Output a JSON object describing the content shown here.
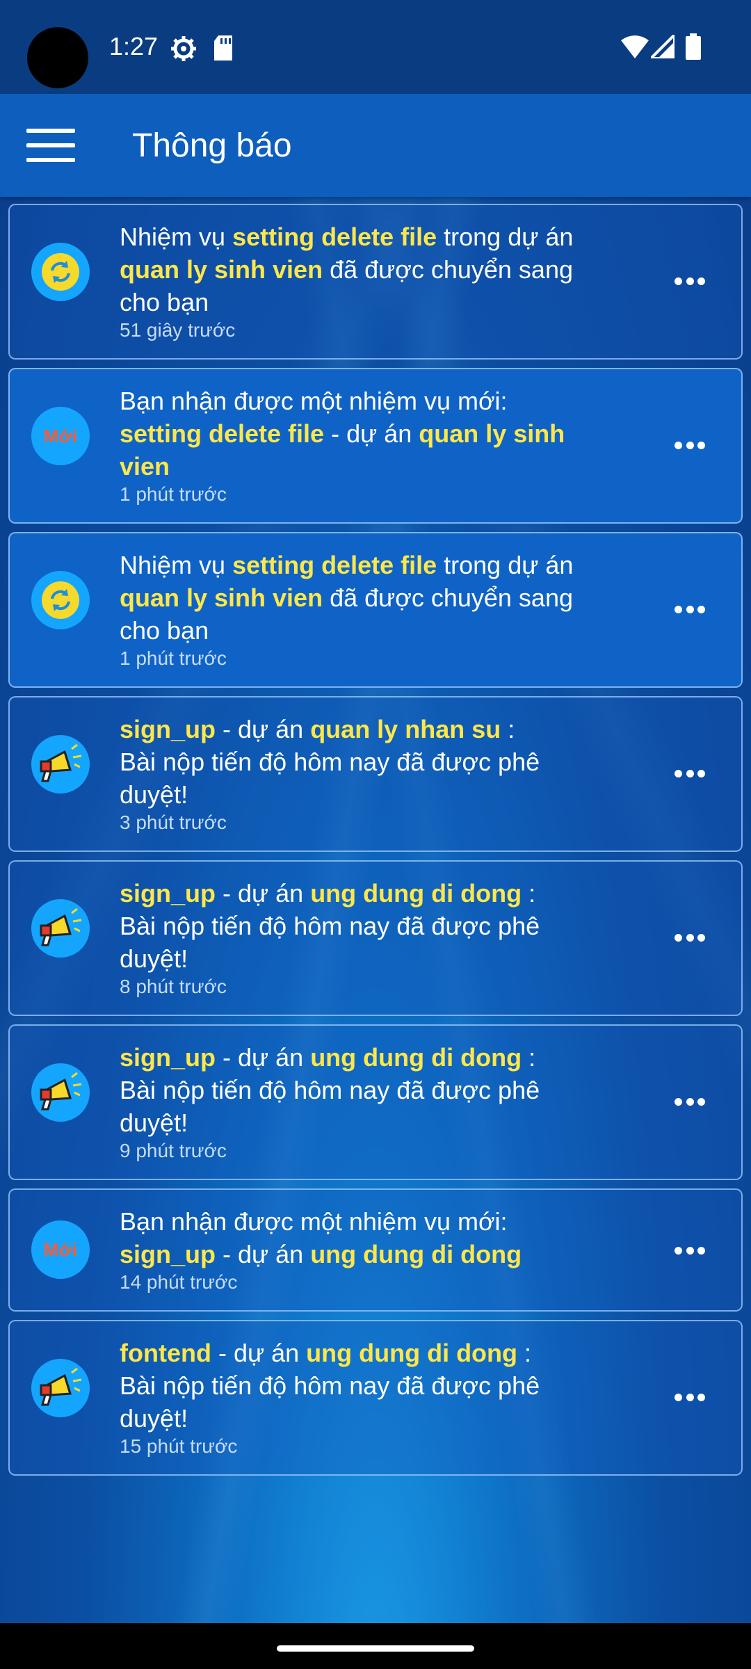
{
  "status_bar": {
    "time": "1:27",
    "icons": [
      "gear-icon",
      "sd-card-icon",
      "wifi-icon",
      "signal-icon",
      "battery-icon"
    ]
  },
  "app_bar": {
    "title": "Thông báo",
    "menu_icon": "hamburger-menu-icon"
  },
  "colors": {
    "highlight": "#ffe74a",
    "new_badge_text": "#ff5a36",
    "avatar_bg": "#14a6ff",
    "appbar_bg": "#0e5fbd"
  },
  "notifications": [
    {
      "avatar": "sync-icon",
      "line1": [
        "Nhiệm vụ ",
        "setting delete file",
        " trong dự án"
      ],
      "line2": [
        "quan ly sinh vien",
        " đã được chuyển sang"
      ],
      "line3": "cho bạn",
      "time": "51 giây trước"
    },
    {
      "avatar": "new-badge",
      "badge_text": "Mới",
      "line1": "Bạn nhận được một nhiệm vụ mới:",
      "line2": [
        "setting delete file",
        " - dự án ",
        "quan ly sinh"
      ],
      "line3": "vien",
      "time": "1 phút trước"
    },
    {
      "avatar": "sync-icon",
      "line1": [
        "Nhiệm vụ ",
        "setting delete file",
        " trong dự án"
      ],
      "line2": [
        "quan ly sinh vien",
        " đã được chuyển sang"
      ],
      "line3": "cho bạn",
      "time": "1 phút trước"
    },
    {
      "avatar": "megaphone-icon",
      "line1": [
        "sign_up",
        " - dự án ",
        "quan ly nhan su",
        " :"
      ],
      "line2": "Bài nộp tiến độ hôm nay đã được phê",
      "line3": "duyệt!",
      "time": "3 phút trước"
    },
    {
      "avatar": "megaphone-icon",
      "line1": [
        "sign_up",
        " - dự án ",
        "ung dung di dong",
        " :"
      ],
      "line2": "Bài nộp tiến độ hôm nay đã được phê",
      "line3": "duyệt!",
      "time": "8 phút trước"
    },
    {
      "avatar": "megaphone-icon",
      "line1": [
        "sign_up",
        " - dự án ",
        "ung dung di dong",
        " :"
      ],
      "line2": "Bài nộp tiến độ hôm nay đã được phê",
      "line3": "duyệt!",
      "time": "9 phút trước"
    },
    {
      "avatar": "new-badge",
      "badge_text": "Mới",
      "line1": "Bạn nhận được một nhiệm vụ mới:",
      "line2": [
        "sign_up",
        " - dự án ",
        "ung dung di dong"
      ],
      "time": "14 phút trước"
    },
    {
      "avatar": "megaphone-icon",
      "line1": [
        "fontend",
        " - dự án ",
        "ung dung di dong",
        " :"
      ],
      "line2": "Bài nộp tiến độ hôm nay đã được phê",
      "line3": "duyệt!",
      "time": "15 phút trước"
    }
  ]
}
